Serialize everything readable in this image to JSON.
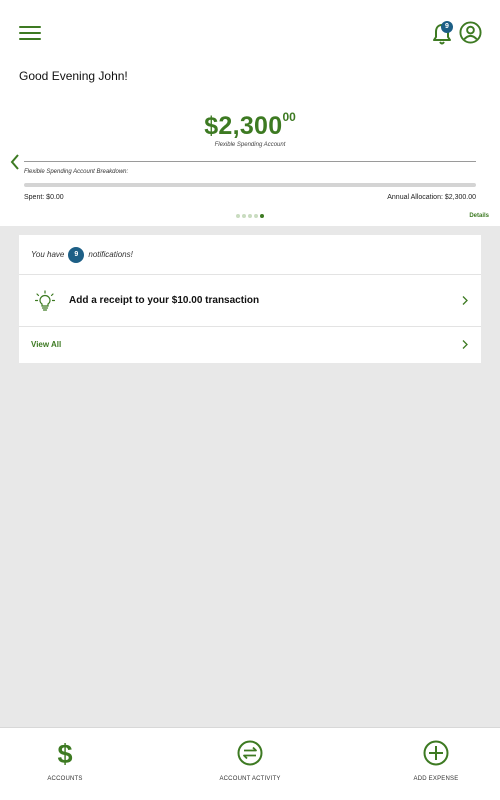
{
  "header": {
    "menu_icon": "hamburger-menu-icon",
    "bell_icon": "bell-icon",
    "bell_badge_count": "9",
    "profile_icon": "user-circle-icon"
  },
  "greeting": "Good Evening John!",
  "account": {
    "amount_main": "$2,300",
    "amount_cents": "00",
    "label": "Flexible Spending Account",
    "breakdown_label": "Flexible Spending Account Breakdown:",
    "spent": "Spent: $0.00",
    "allocation": "Annual Allocation: $2,300.00",
    "spent_fraction": 0,
    "details_label": "Details",
    "page_indicator": {
      "total": 5,
      "active": 5
    }
  },
  "notifications": {
    "prefix": "You have",
    "count": "9",
    "suffix": "notifications!",
    "items": [
      {
        "icon": "lightbulb-icon",
        "text": "Add a receipt to your $10.00 transaction"
      }
    ],
    "view_all_label": "View All"
  },
  "bottom_nav": {
    "items": [
      {
        "icon": "dollar-icon",
        "label": "ACCOUNTS"
      },
      {
        "icon": "account-activity-icon",
        "label": "ACCOUNT ACTIVITY"
      },
      {
        "icon": "plus-circle-icon",
        "label": "ADD EXPENSE"
      }
    ]
  },
  "colors": {
    "brand_green": "#3d7a22",
    "badge_blue": "#1d5f86",
    "background_gray": "#e8e8e8"
  }
}
